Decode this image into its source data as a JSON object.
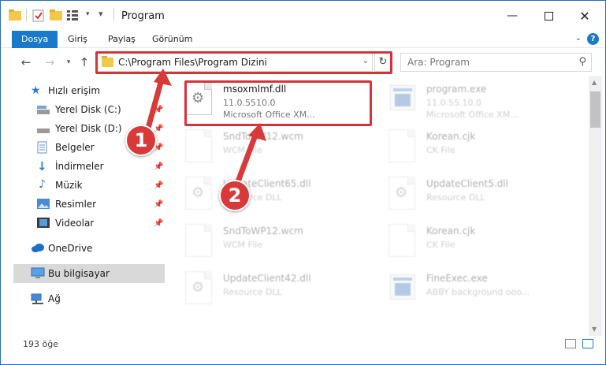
{
  "window": {
    "title": "Program"
  },
  "ribbon": {
    "tabs": [
      "Dosya",
      "Giriş",
      "Paylaş",
      "Görünüm"
    ],
    "help": "?"
  },
  "nav": {
    "address_path": "C:\\Program Files\\Program Dizini",
    "search_placeholder": "Ara: Program"
  },
  "sidebar": {
    "items": [
      {
        "label": "Hızlı erişim",
        "icon": "star-icon"
      },
      {
        "label": "Yerel Disk (C:)",
        "icon": "drive-icon"
      },
      {
        "label": "Yerel Disk (D:)",
        "icon": "drive-icon"
      },
      {
        "label": "Belgeler",
        "icon": "documents-icon"
      },
      {
        "label": "İndirmeler",
        "icon": "download-icon"
      },
      {
        "label": "Müzik",
        "icon": "music-icon"
      },
      {
        "label": "Resimler",
        "icon": "pictures-icon"
      },
      {
        "label": "Videolar",
        "icon": "videos-icon"
      },
      {
        "label": "OneDrive",
        "icon": "cloud-icon"
      },
      {
        "label": "Bu bilgisayar",
        "icon": "computer-icon"
      },
      {
        "label": "Ağ",
        "icon": "network-icon"
      }
    ]
  },
  "files": [
    {
      "name": "msoxmlmf.dll",
      "line1": "11.0.5510.0",
      "line2": "Microsoft Office XM..."
    },
    {
      "name": "program.exe",
      "line1": "11.0.55.10.0",
      "line2": "Microsoft Office XM..."
    },
    {
      "name": "SndToWP12.wcm",
      "line1": "WCM File",
      "line2": ""
    },
    {
      "name": "Korean.cjk",
      "line1": "CK File",
      "line2": ""
    },
    {
      "name": "UpdateClient65.dll",
      "line1": "Resource DLL",
      "line2": ""
    },
    {
      "name": "UpdateClient5.dll",
      "line1": "Resource DLL",
      "line2": ""
    },
    {
      "name": "SndToWP12.wcm",
      "line1": "WCM File",
      "line2": ""
    },
    {
      "name": "Korean.cjk",
      "line1": "CK File",
      "line2": ""
    },
    {
      "name": "UpdateClient42.dll",
      "line1": "Resource DLL",
      "line2": ""
    },
    {
      "name": "FineExec.exe",
      "line1": "ABBY background ooo...",
      "line2": ""
    }
  ],
  "status": {
    "count": "193 öğe"
  },
  "annotations": {
    "marker1": "1",
    "marker2": "2",
    "color": "#d9313c"
  }
}
